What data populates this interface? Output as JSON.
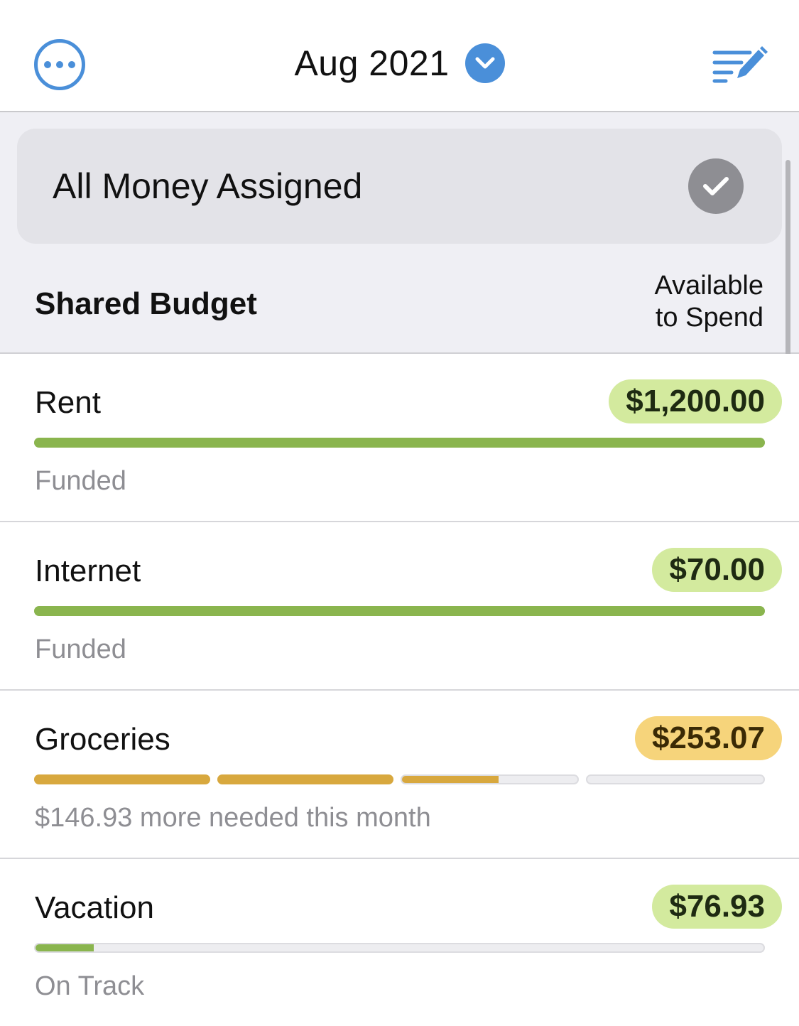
{
  "header": {
    "month_label": "Aug 2021",
    "accent_color": "#4a8fd9",
    "left_icon": "more-icon",
    "title_icon": "chevron-down-icon",
    "right_icon": "edit-list-icon"
  },
  "assigned_banner": {
    "label": "All Money Assigned",
    "icon": "checkmark-icon"
  },
  "section": {
    "title": "Shared Budget",
    "column_label_line1": "Available",
    "column_label_line2": "to Spend"
  },
  "categories": [
    {
      "name": "Rent",
      "amount": "$1,200.00",
      "amount_color": "#d3ea9e",
      "status": "Funded",
      "progress_segments": [
        1.0
      ],
      "bar_color": "#8ab54e"
    },
    {
      "name": "Internet",
      "amount": "$70.00",
      "amount_color": "#d3ea9e",
      "status": "Funded",
      "progress_segments": [
        1.0
      ],
      "bar_color": "#8ab54e"
    },
    {
      "name": "Groceries",
      "amount": "$253.07",
      "amount_color": "#f6d47b",
      "status": "$146.93 more needed this month",
      "progress_segments": [
        1.0,
        1.0,
        0.55,
        0.0
      ],
      "bar_color": "#d8a83e"
    },
    {
      "name": "Vacation",
      "amount": "$76.93",
      "amount_color": "#d3ea9e",
      "status": "On Track",
      "progress_segments": [
        0.08
      ],
      "bar_color": "#8ab54e"
    }
  ]
}
